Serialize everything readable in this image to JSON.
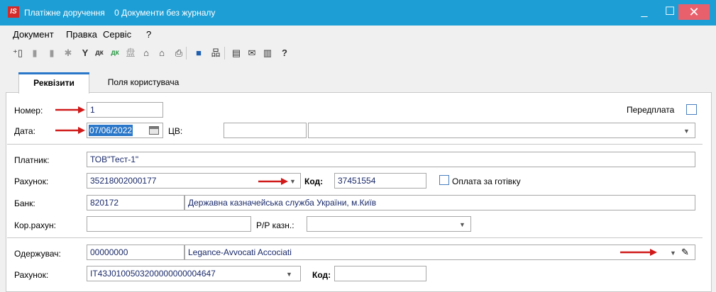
{
  "window": {
    "logo_text": "IS",
    "title": "Платіжне доручення",
    "subtitle": "0 Документи без журналу",
    "minimize_glyph": "_",
    "maximize_glyph": "☐",
    "close_glyph": "✕"
  },
  "menu": [
    "Документ",
    "Правка",
    "Сервіс",
    "?"
  ],
  "toolbar_icons": [
    "new-document-icon",
    "copy-document-icon",
    "delete-document-icon",
    "link-icon",
    "filter-icon",
    "debit-credit-icon",
    "debit-credit-green-icon",
    "report-icon",
    "open-icon",
    "open-alt-icon",
    "print-icon",
    "save-icon",
    "tree-icon",
    "document-icon",
    "mail-icon",
    "archive-icon",
    "help-icon"
  ],
  "tabs": {
    "requisites": "Реквізити",
    "user_fields": "Поля користувача"
  },
  "form": {
    "number_label": "Номер:",
    "number_value": "1",
    "prepayment_label": "Передплата",
    "date_label": "Дата:",
    "date_value": "07/06/2022",
    "cv_label": "ЦВ:",
    "payer_label": "Платник:",
    "payer_value": "ТОВ\"Тест-1\"",
    "account_label": "Рахунок:",
    "account_value": "35218002000177",
    "code_label": "Код:",
    "code_value": "37451554",
    "cash_payment_label": "Оплата за готівку",
    "bank_label": "Банк:",
    "bank_code": "820172",
    "bank_name": "Державна казначейська служба України, м.Київ",
    "corr_account_label": "Кор.рахун:",
    "rr_label": "Р/Р казн.:",
    "recipient_label": "Одержувач:",
    "recipient_code": "00000000",
    "recipient_name": "Legance-Avvocati Accociati",
    "recipient_account_label": "Рахунок:",
    "recipient_account_value": "IT43J0100503200000000004647",
    "recipient_code_label": "Код:"
  },
  "colors": {
    "titlebar": "#1d9fd6",
    "close_button": "#e9606d",
    "accent": "#2a77c9",
    "arrow": "#d01a1a"
  }
}
